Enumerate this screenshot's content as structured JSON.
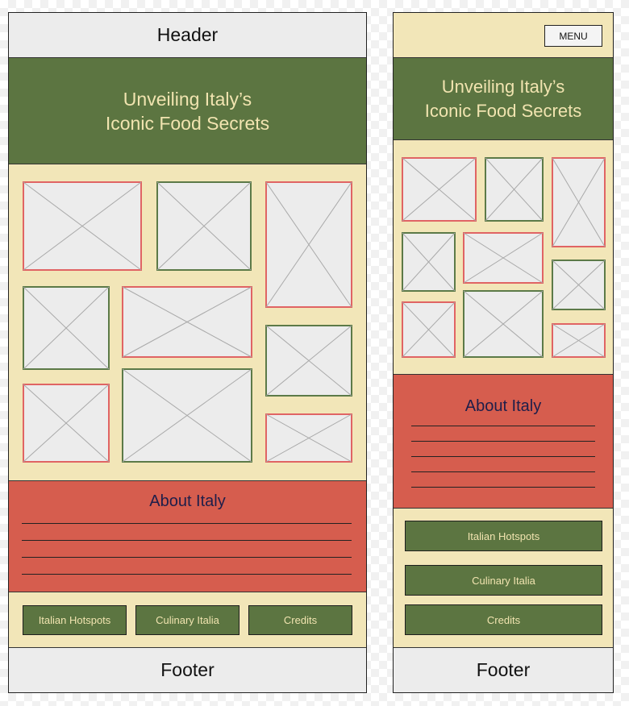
{
  "colors": {
    "header_footer_bg": "#ececec",
    "cream_bg": "#f2e6b8",
    "green": "#5c7541",
    "red": "#d65d4e",
    "hero_text": "#f1e4b0",
    "about_title": "#1e1e4a",
    "placeholder_red_border": "#e06464",
    "placeholder_green_border": "#5c7a48"
  },
  "desktop": {
    "header": "Header",
    "hero_title": "Unveiling Italy’s\nIconic Food Secrets",
    "about_title": "About Italy",
    "nav": [
      "Italian Hotspots",
      "Culinary Italia",
      "Credits"
    ],
    "footer": "Footer"
  },
  "mobile": {
    "menu_label": "MENU",
    "hero_title": "Unveiling Italy’s\nIconic Food Secrets",
    "about_title": "About Italy",
    "nav": [
      "Italian Hotspots",
      "Culinary Italia",
      "Credits"
    ],
    "footer": "Footer"
  }
}
